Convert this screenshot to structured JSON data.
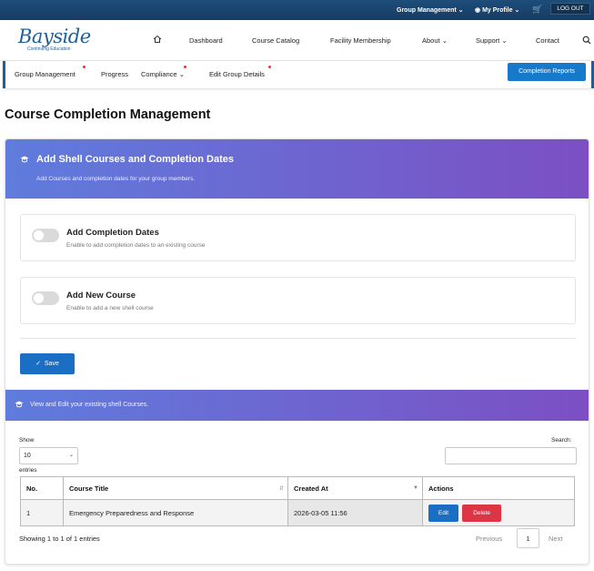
{
  "topbar": {
    "group_management": "Group Management",
    "my_profile": "My Profile",
    "logout": "LOG OUT"
  },
  "brand": {
    "name": "Bayside",
    "tagline": "Continuing Education"
  },
  "nav": {
    "items": [
      "Dashboard",
      "Course Catalog",
      "Facility Membership",
      "About",
      "Support",
      "Contact"
    ]
  },
  "subnav": {
    "items": [
      "Group Management",
      "Progress",
      "Compliance",
      "Edit Group Details"
    ],
    "completion_reports": "Completion Reports"
  },
  "page": {
    "title": "Course Completion Management"
  },
  "card": {
    "title": "Add Shell Courses and Completion Dates",
    "subtitle": "Add Courses and completion dates for your group members.",
    "toggles": [
      {
        "title": "Add Completion Dates",
        "desc": "Enable to add completion dates to an existing course",
        "on": false
      },
      {
        "title": "Add New Course",
        "desc": "Enable to add a new shell course",
        "on": false
      }
    ],
    "save_label": "Save",
    "band_text": "View and Edit your existing shell Courses."
  },
  "table_controls": {
    "show_label": "Show",
    "page_length": "10",
    "entries_label": "entries",
    "search_label": "Search:",
    "search_value": ""
  },
  "table": {
    "columns": [
      "No.",
      "Course Title",
      "Created At",
      "Actions"
    ],
    "rows": [
      {
        "no": "1",
        "title": "Emergency Preparedness and Response",
        "created_at": "2026-03-05 11:56",
        "edit": "Edit",
        "delete": "Delete"
      }
    ]
  },
  "footer": {
    "info": "Showing 1 to 1 of 1 entries",
    "previous": "Previous",
    "current_page": "1",
    "next": "Next"
  },
  "colors": {
    "topbar": "#1d4d7a",
    "brand_blue": "#1f5f96",
    "gradient_start": "#5f7cdc",
    "gradient_end": "#7c4fc4",
    "primary_button": "#1a6fc4",
    "danger_button": "#dc3545",
    "notification_dot": "#e53935"
  }
}
